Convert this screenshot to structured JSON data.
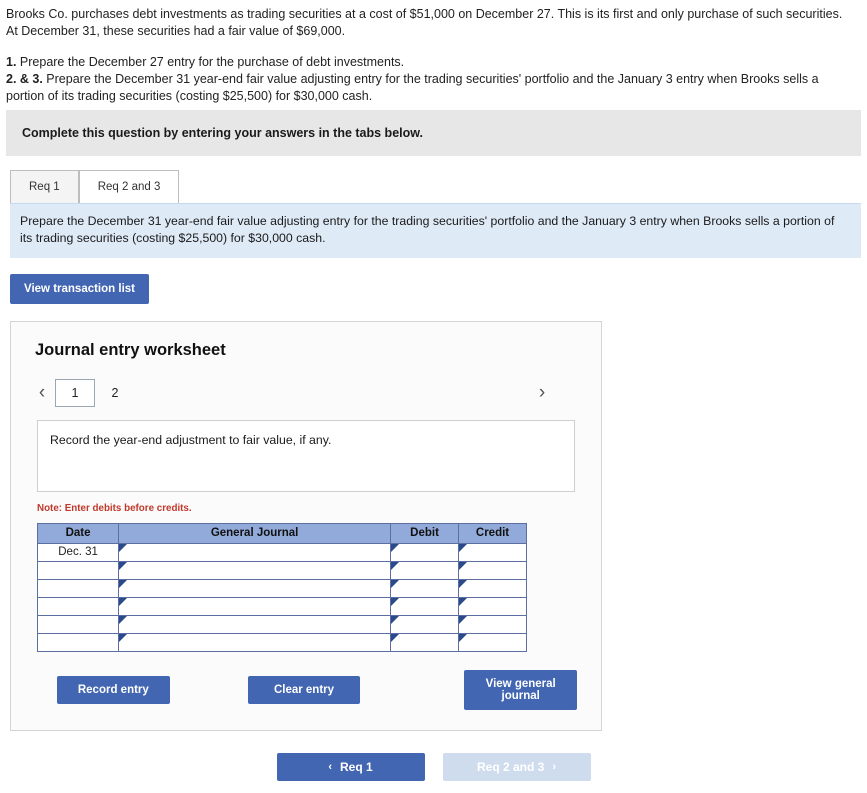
{
  "problem": {
    "intro": "Brooks Co. purchases debt investments as trading securities at a cost of $51,000 on December 27. This is its first and only purchase of such securities. At December 31, these securities had a fair value of $69,000.",
    "req1_label": "1.",
    "req1_text": " Prepare the December 27 entry for the purchase of debt investments.",
    "req23_label": "2. & 3.",
    "req23_text": " Prepare the December 31 year-end fair value adjusting entry for the trading securities' portfolio and the January 3 entry when Brooks sells a portion of its trading securities (costing $25,500) for $30,000 cash."
  },
  "gray_banner": "Complete this question by entering your answers in the tabs below.",
  "tabs": [
    {
      "label": "Req 1",
      "active": false
    },
    {
      "label": "Req 2 and 3",
      "active": true
    }
  ],
  "blue_banner": "Prepare the December 31 year-end fair value adjusting entry for the trading securities' portfolio and the January 3 entry when Brooks sells a portion of its trading securities (costing $25,500) for $30,000 cash.",
  "view_transaction_list": "View transaction list",
  "worksheet": {
    "title": "Journal entry worksheet",
    "prev_icon": "‹",
    "next_icon": "›",
    "pages": [
      {
        "label": "1",
        "active": true
      },
      {
        "label": "2",
        "active": false
      }
    ],
    "record_prompt": "Record the year-end adjustment to fair value, if any.",
    "note": "Note: Enter debits before credits.",
    "table": {
      "headers": [
        "Date",
        "General Journal",
        "Debit",
        "Credit"
      ],
      "rows": [
        {
          "date": "Dec. 31",
          "general_journal": "",
          "debit": "",
          "credit": ""
        },
        {
          "date": "",
          "general_journal": "",
          "debit": "",
          "credit": ""
        },
        {
          "date": "",
          "general_journal": "",
          "debit": "",
          "credit": ""
        },
        {
          "date": "",
          "general_journal": "",
          "debit": "",
          "credit": ""
        },
        {
          "date": "",
          "general_journal": "",
          "debit": "",
          "credit": ""
        },
        {
          "date": "",
          "general_journal": "",
          "debit": "",
          "credit": ""
        }
      ]
    },
    "buttons": {
      "record_entry": "Record entry",
      "clear_entry": "Clear entry",
      "view_general_journal": "View general journal"
    }
  },
  "footer": {
    "prev_label": "Req 1",
    "prev_icon": "‹",
    "next_label": "Req 2 and 3",
    "next_icon": "›"
  },
  "colors": {
    "accent_blue": "#4266b2",
    "disabled_blue": "#cfdcee",
    "banner_gray": "#e7e7e7",
    "banner_blue": "#dfeaf7",
    "table_header": "#92aad9",
    "note_red": "#c0392b"
  }
}
